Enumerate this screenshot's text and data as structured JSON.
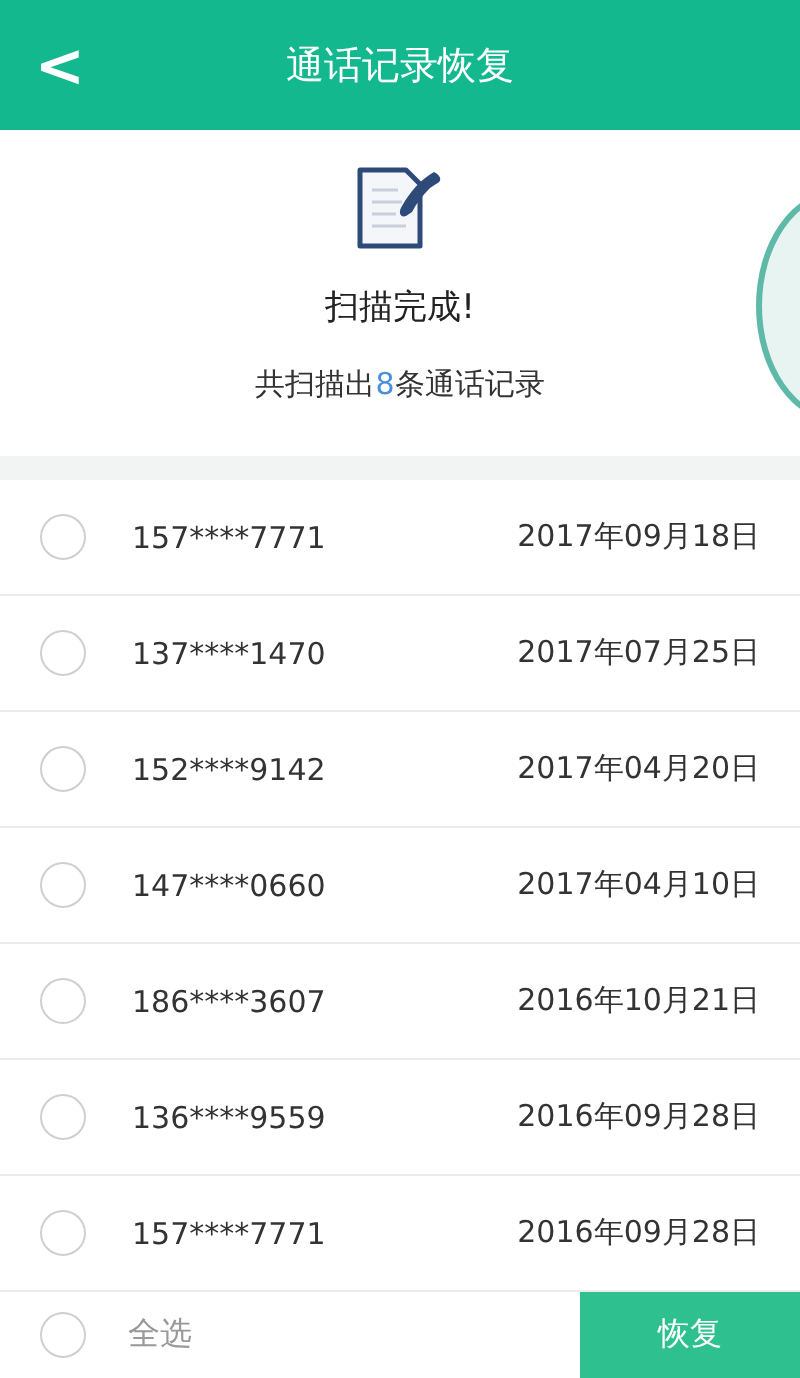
{
  "header": {
    "back": "<",
    "title": "通话记录恢复"
  },
  "scan": {
    "status": "扫描完成!",
    "summary": {
      "prefix": "共扫描出",
      "count": "8",
      "suffix": "条通话记录"
    }
  },
  "records": [
    {
      "number": "157****7771",
      "date": "2017年09月18日",
      "selected": false
    },
    {
      "number": "137****1470",
      "date": "2017年07月25日",
      "selected": false
    },
    {
      "number": "152****9142",
      "date": "2017年04月20日",
      "selected": false
    },
    {
      "number": "147****0660",
      "date": "2017年04月10日",
      "selected": false
    },
    {
      "number": "186****3607",
      "date": "2016年10月21日",
      "selected": false
    },
    {
      "number": "136****9559",
      "date": "2016年09月28日",
      "selected": false
    },
    {
      "number": "157****7771",
      "date": "2016年09月28日",
      "selected": false
    }
  ],
  "footer": {
    "select_all": {
      "label": "全选",
      "selected": false
    },
    "restore": "恢复"
  }
}
